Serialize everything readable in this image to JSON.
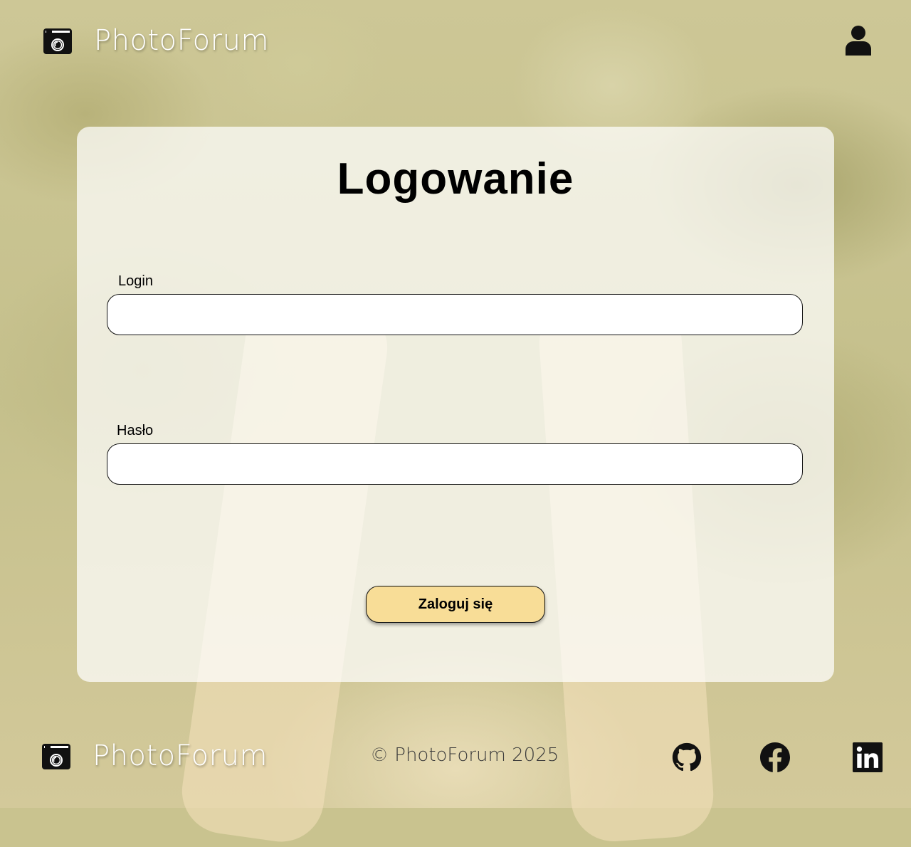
{
  "header": {
    "brand": "PhotoForum",
    "logo_icon": "camera-icon",
    "user_icon": "user-icon"
  },
  "login_form": {
    "title": "Logowanie",
    "login_label": "Login",
    "login_value": "",
    "password_label": "Hasło",
    "password_value": "",
    "submit_label": "Zaloguj się"
  },
  "footer": {
    "brand": "PhotoForum",
    "copyright": "© PhotoForum 2025",
    "social_icons": [
      "github-icon",
      "facebook-icon",
      "linkedin-icon"
    ]
  },
  "colors": {
    "button_bg": "#f8dd97",
    "card_bg": "rgba(255,255,255,0.72)",
    "brand_text": "#ffffff"
  }
}
